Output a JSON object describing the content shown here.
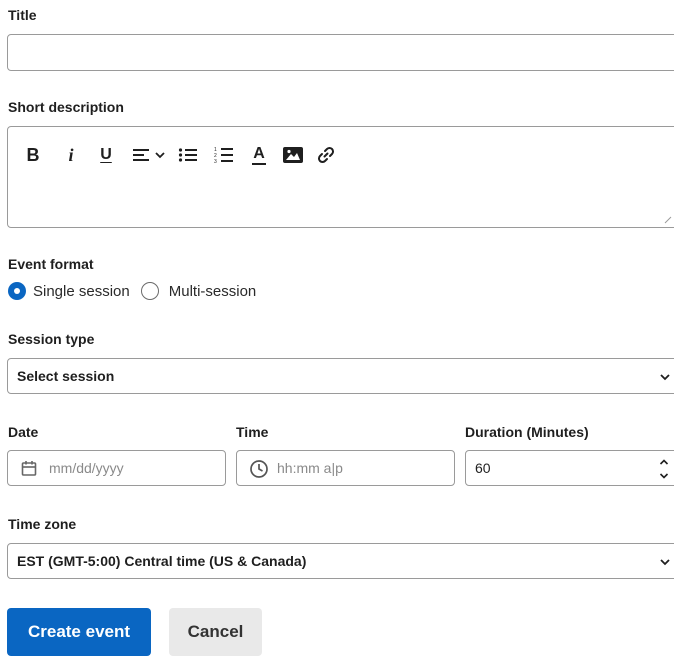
{
  "title_field": {
    "label": "Title",
    "value": ""
  },
  "short_description": {
    "label": "Short description",
    "toolbar": {
      "bold": "B",
      "italic": "i",
      "underline": "U",
      "align": "align-left-icon",
      "bullets": "bulleted-list-icon",
      "numbers": "numbered-list-icon",
      "text_color": "A",
      "image": "image-icon",
      "link": "link-icon"
    },
    "value": ""
  },
  "event_format": {
    "label": "Event format",
    "options": [
      {
        "label": "Single session",
        "selected": true
      },
      {
        "label": "Multi-session",
        "selected": false
      }
    ]
  },
  "session_type": {
    "label": "Session type",
    "selected": "Select session"
  },
  "date": {
    "label": "Date",
    "placeholder": "mm/dd/yyyy"
  },
  "time": {
    "label": "Time",
    "placeholder": "hh:mm a|p"
  },
  "duration": {
    "label": "Duration (Minutes)",
    "value": "60"
  },
  "time_zone": {
    "label": "Time zone",
    "selected": "EST (GMT-5:00) Central time (US & Canada)"
  },
  "actions": {
    "create_label": "Create event",
    "cancel_label": "Cancel"
  },
  "colors": {
    "primary": "#0a66c2",
    "secondary_bg": "#e9e9e9",
    "border": "#9a9a9a"
  }
}
